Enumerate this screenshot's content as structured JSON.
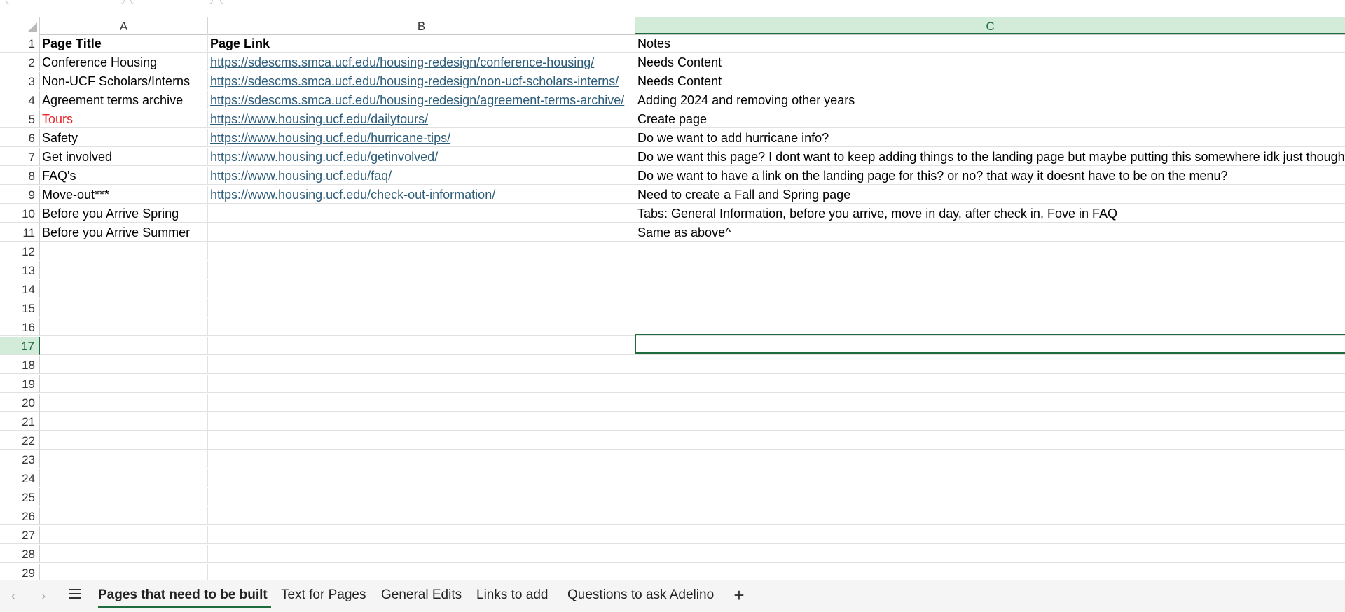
{
  "columns": {
    "a": "A",
    "b": "B",
    "c": "C"
  },
  "rows": [
    {
      "n": "1",
      "a": "Page Title",
      "b": "Page Link",
      "c": "Notes"
    },
    {
      "n": "2",
      "a": "Conference Housing",
      "b": "https://sdescms.smca.ucf.edu/housing-redesign/conference-housing/",
      "c": "Needs Content"
    },
    {
      "n": "3",
      "a": "Non-UCF Scholars/Interns",
      "b": "https://sdescms.smca.ucf.edu/housing-redesign/non-ucf-scholars-interns/",
      "c": "Needs Content"
    },
    {
      "n": "4",
      "a": "Agreement terms archive",
      "b": "https://sdescms.smca.ucf.edu/housing-redesign/agreement-terms-archive/",
      "c": "Adding 2024 and removing other years"
    },
    {
      "n": "5",
      "a": "Tours",
      "b": "https://www.housing.ucf.edu/dailytours/",
      "c": "Create page"
    },
    {
      "n": "6",
      "a": "Safety",
      "b": "https://www.housing.ucf.edu/hurricane-tips/",
      "c": "Do we want to add hurricane info?"
    },
    {
      "n": "7",
      "a": "Get involved",
      "b": "https://www.housing.ucf.edu/getinvolved/",
      "c": "Do we want this page? I dont want to keep adding things to the landing page but maybe putting this somewhere idk just thought dur"
    },
    {
      "n": "8",
      "a": "FAQ's",
      "b": "https://www.housing.ucf.edu/faq/",
      "c": "Do we want to have a link on the landing page for this? or no? that way it doesnt have to be on the menu?"
    },
    {
      "n": "9",
      "a": "Move-out***",
      "b": "https://www.housing.ucf.edu/check-out-information/",
      "c": "Need to create a Fall and Spring page"
    },
    {
      "n": "10",
      "a": "Before you Arrive Spring",
      "b": "",
      "c": "Tabs: General Information, before you arrive, move in day, after check in, Fove in FAQ"
    },
    {
      "n": "11",
      "a": "Before you Arrive Summer",
      "b": "",
      "c": "Same as above^"
    },
    {
      "n": "12",
      "a": "",
      "b": "",
      "c": ""
    },
    {
      "n": "13",
      "a": "",
      "b": "",
      "c": ""
    },
    {
      "n": "14",
      "a": "",
      "b": "",
      "c": ""
    },
    {
      "n": "15",
      "a": "",
      "b": "",
      "c": ""
    },
    {
      "n": "16",
      "a": "",
      "b": "",
      "c": ""
    },
    {
      "n": "17",
      "a": "",
      "b": "",
      "c": ""
    },
    {
      "n": "18",
      "a": "",
      "b": "",
      "c": ""
    },
    {
      "n": "19",
      "a": "",
      "b": "",
      "c": ""
    },
    {
      "n": "20",
      "a": "",
      "b": "",
      "c": ""
    },
    {
      "n": "21",
      "a": "",
      "b": "",
      "c": ""
    },
    {
      "n": "22",
      "a": "",
      "b": "",
      "c": ""
    },
    {
      "n": "23",
      "a": "",
      "b": "",
      "c": ""
    },
    {
      "n": "24",
      "a": "",
      "b": "",
      "c": ""
    },
    {
      "n": "25",
      "a": "",
      "b": "",
      "c": ""
    },
    {
      "n": "26",
      "a": "",
      "b": "",
      "c": ""
    },
    {
      "n": "27",
      "a": "",
      "b": "",
      "c": ""
    },
    {
      "n": "28",
      "a": "",
      "b": "",
      "c": ""
    },
    {
      "n": "29",
      "a": "",
      "b": "",
      "c": ""
    }
  ],
  "selected_row": "17",
  "selected_column": "C",
  "sheet_tabs": [
    {
      "label": "Pages that need to be built",
      "active": true
    },
    {
      "label": "Text for Pages",
      "active": false
    },
    {
      "label": "General Edits",
      "active": false
    },
    {
      "label": "Links to add",
      "active": false
    },
    {
      "label": "Questions to ask Adelino",
      "active": false
    }
  ],
  "nav": {
    "prev_icon": "‹",
    "next_icon": "›",
    "add_icon": "+"
  },
  "colors": {
    "accent": "#1e6b3d",
    "selection_fill": "#d2ecd9",
    "link": "#2e5d7a",
    "red_text": "#e8262d"
  }
}
